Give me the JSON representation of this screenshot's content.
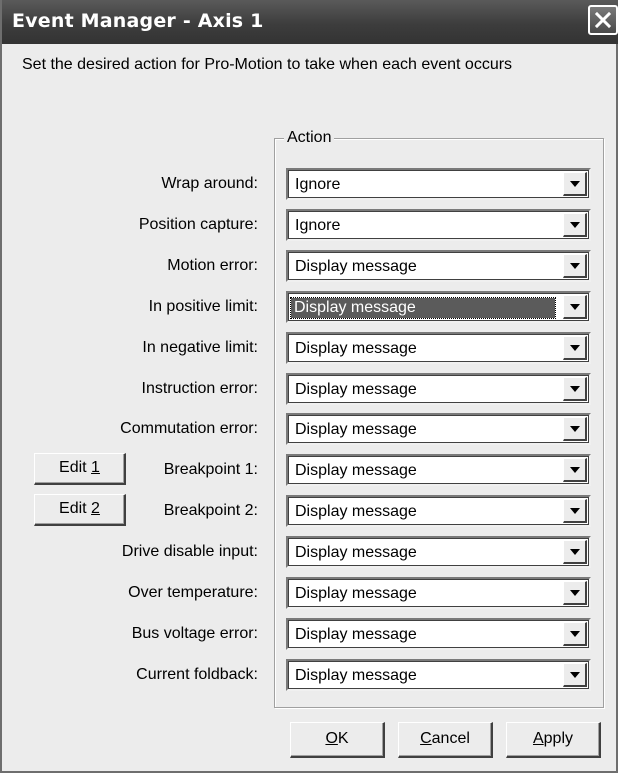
{
  "window": {
    "title": "Event Manager - Axis 1",
    "prompt": "Set the desired action for Pro-Motion to take when each event occurs"
  },
  "group": {
    "legend": "Action"
  },
  "events": [
    {
      "label": "Wrap around:",
      "value": "Ignore"
    },
    {
      "label": "Position capture:",
      "value": "Ignore"
    },
    {
      "label": "Motion error:",
      "value": "Display message"
    },
    {
      "label": "In positive limit:",
      "value": "Display message",
      "focused": true
    },
    {
      "label": "In negative limit:",
      "value": "Display message"
    },
    {
      "label": "Instruction error:",
      "value": "Display message"
    },
    {
      "label": "Commutation error:",
      "value": "Display message"
    },
    {
      "label": "Breakpoint 1:",
      "value": "Display message"
    },
    {
      "label": "Breakpoint 2:",
      "value": "Display message"
    },
    {
      "label": "Drive disable input:",
      "value": "Display message"
    },
    {
      "label": "Over temperature:",
      "value": "Display message"
    },
    {
      "label": "Bus voltage error:",
      "value": "Display message"
    },
    {
      "label": "Current foldback:",
      "value": "Display message"
    }
  ],
  "edit_buttons": {
    "edit1_prefix": "Edit ",
    "edit1_mnemonic": "1",
    "edit2_prefix": "Edit ",
    "edit2_mnemonic": "2"
  },
  "footer": {
    "ok_mnemonic": "O",
    "ok_rest": "K",
    "cancel_mnemonic": "C",
    "cancel_rest": "ancel",
    "apply_mnemonic": "A",
    "apply_rest": "pply"
  },
  "icons": {
    "close": "close-icon",
    "dropdown": "chevron-down-icon"
  }
}
